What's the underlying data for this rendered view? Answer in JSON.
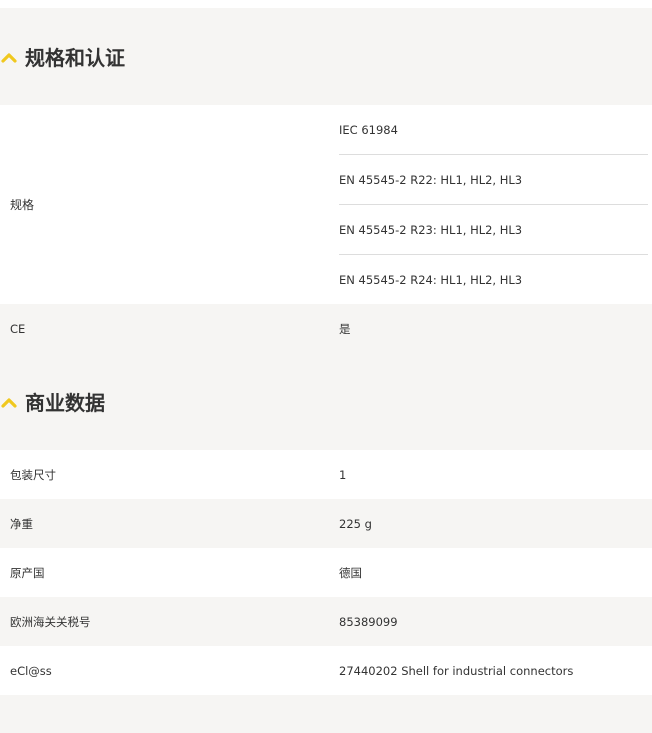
{
  "sections": [
    {
      "title": "规格和认证",
      "icon": "chevron-up-icon",
      "rows": [
        {
          "label": "规格",
          "values": [
            "IEC 61984",
            "EN 45545-2 R22: HL1, HL2, HL3",
            "EN 45545-2 R23: HL1, HL2, HL3",
            "EN 45545-2 R24: HL1, HL2, HL3"
          ]
        },
        {
          "label": "CE",
          "value": "是"
        }
      ]
    },
    {
      "title": "商业数据",
      "icon": "chevron-up-icon",
      "rows": [
        {
          "label": "包装尺寸",
          "value": "1"
        },
        {
          "label": "净重",
          "value": "225 g"
        },
        {
          "label": "原产国",
          "value": "德国"
        },
        {
          "label": "欧洲海关关税号",
          "value": "85389099"
        },
        {
          "label": "eCl@ss",
          "value": "27440202 Shell for industrial connectors"
        }
      ]
    }
  ],
  "colors": {
    "accent": "#f0c81e",
    "row_white": "#ffffff",
    "row_grey": "#f6f5f3",
    "divider": "#dddddd"
  }
}
